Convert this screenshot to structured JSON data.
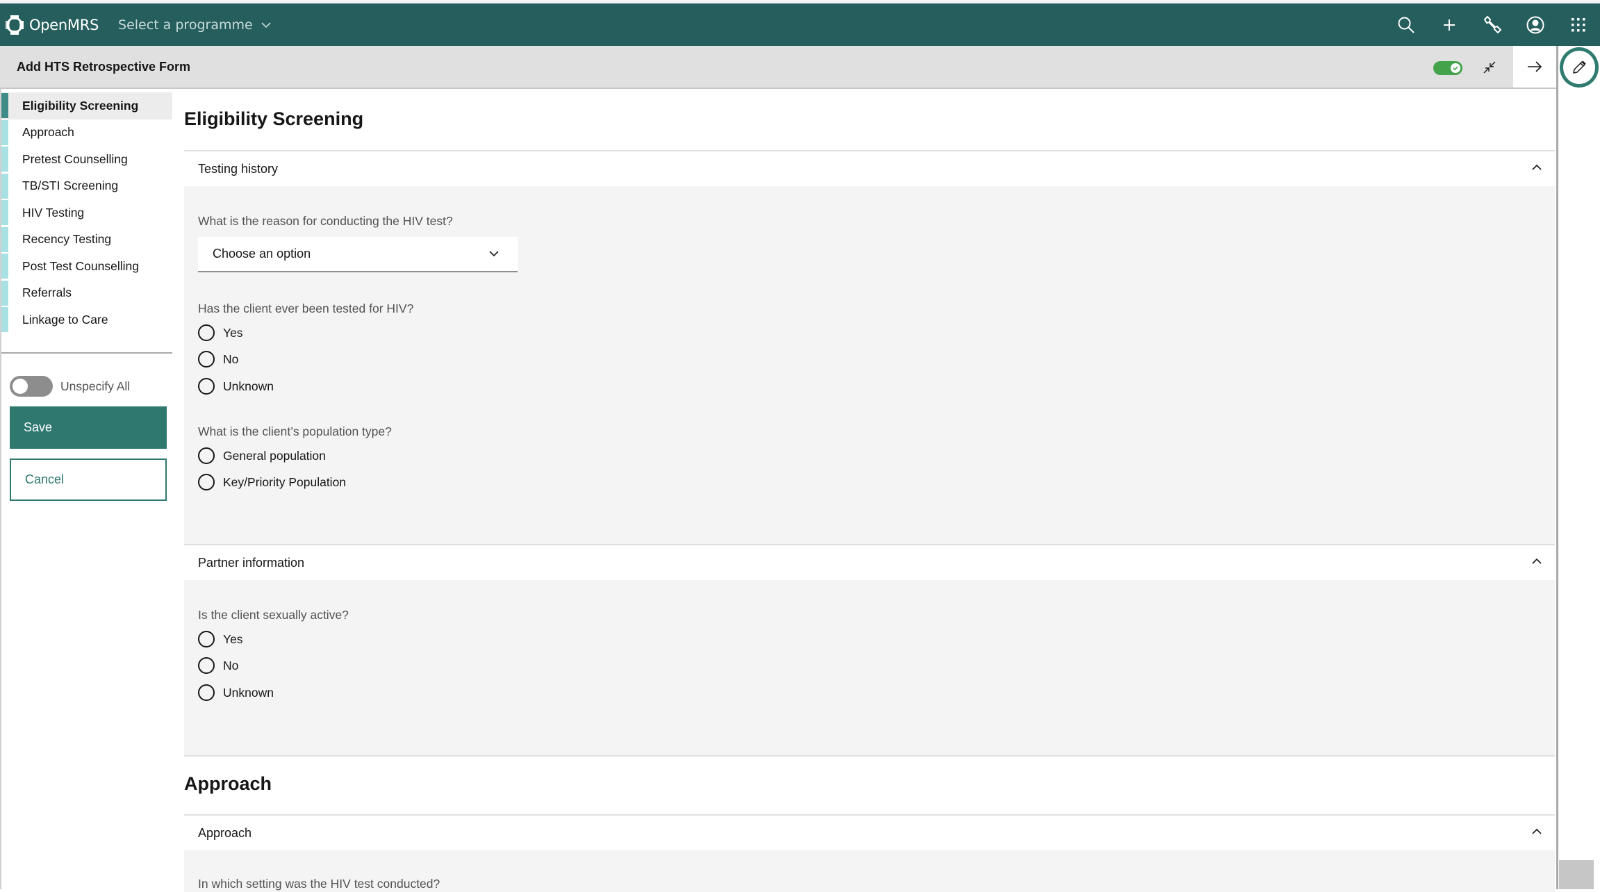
{
  "topbar": {
    "brand": "OpenMRS",
    "programme_selector": "Select a programme",
    "icons": [
      "search-icon",
      "add-icon",
      "wrench-icon",
      "user-avatar-icon",
      "app-switcher-icon"
    ]
  },
  "form_header": {
    "title": "Add HTS Retrospective Form",
    "toggle_on": true
  },
  "sidebar": {
    "items": [
      {
        "label": "Eligibility Screening",
        "active": true
      },
      {
        "label": "Approach",
        "active": false
      },
      {
        "label": "Pretest Counselling",
        "active": false
      },
      {
        "label": "TB/STI Screening",
        "active": false
      },
      {
        "label": "HIV Testing",
        "active": false
      },
      {
        "label": "Recency Testing",
        "active": false
      },
      {
        "label": "Post Test Counselling",
        "active": false
      },
      {
        "label": "Referrals",
        "active": false
      },
      {
        "label": "Linkage to Care",
        "active": false
      }
    ],
    "unspecify_all_label": "Unspecify All",
    "unspecify_all_on": false,
    "save_label": "Save",
    "cancel_label": "Cancel"
  },
  "main": {
    "sections": [
      {
        "title": "Eligibility Screening",
        "accordions": [
          {
            "title": "Testing history",
            "expanded": true,
            "questions": [
              {
                "label": "What is the reason for conducting the HIV test?",
                "type": "select",
                "value": "Choose an option"
              },
              {
                "label": "Has the client ever been tested for HIV?",
                "type": "radio",
                "options": [
                  "Yes",
                  "No",
                  "Unknown"
                ]
              },
              {
                "label": "What is the client’s population type?",
                "type": "radio",
                "options": [
                  "General population",
                  "Key/Priority Population"
                ]
              }
            ]
          },
          {
            "title": "Partner information",
            "expanded": true,
            "questions": [
              {
                "label": "Is the client sexually active?",
                "type": "radio",
                "options": [
                  "Yes",
                  "No",
                  "Unknown"
                ]
              }
            ]
          }
        ]
      },
      {
        "title": "Approach",
        "accordions": [
          {
            "title": "Approach",
            "expanded": true,
            "questions": [
              {
                "label": "In which setting was the HIV test conducted?",
                "type": "unknown"
              }
            ]
          }
        ]
      }
    ]
  },
  "colors": {
    "topbar": "#255e5c",
    "primary_button": "#2f7870",
    "toggle_on": "#42a34b",
    "active_marker": "#3f8c89",
    "inactive_marker": "#a8e0e3"
  }
}
